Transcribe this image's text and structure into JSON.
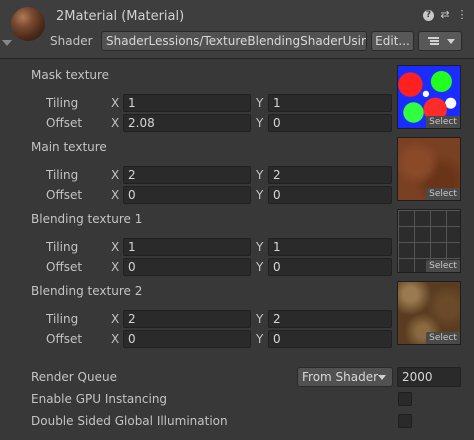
{
  "header": {
    "title": "2Material (Material)",
    "shader_label": "Shader",
    "shader_value": "ShaderLessions/TextureBlendingShaderUsir",
    "edit_label": "Edit...",
    "icons": [
      "help-icon",
      "settings-sliders-icon",
      "more-vert-icon",
      "list-icon"
    ]
  },
  "textures": [
    {
      "label": "Mask texture",
      "tiling_label": "Tiling",
      "offset_label": "Offset",
      "tiling_x": "1",
      "tiling_y": "1",
      "offset_x": "2.08",
      "offset_y": "0",
      "select_label": "Select"
    },
    {
      "label": "Main texture",
      "tiling_label": "Tiling",
      "offset_label": "Offset",
      "tiling_x": "2",
      "tiling_y": "2",
      "offset_x": "0",
      "offset_y": "0",
      "select_label": "Select"
    },
    {
      "label": "Blending texture 1",
      "tiling_label": "Tiling",
      "offset_label": "Offset",
      "tiling_x": "1",
      "tiling_y": "1",
      "offset_x": "0",
      "offset_y": "0",
      "select_label": "Select"
    },
    {
      "label": "Blending texture 2",
      "tiling_label": "Tiling",
      "offset_label": "Offset",
      "tiling_x": "2",
      "tiling_y": "2",
      "offset_x": "0",
      "offset_y": "0",
      "select_label": "Select"
    }
  ],
  "axis": {
    "x": "X",
    "y": "Y"
  },
  "render_queue": {
    "label": "Render Queue",
    "mode": "From Shader",
    "value": "2000"
  },
  "gpu_instancing": {
    "label": "Enable GPU Instancing",
    "checked": false
  },
  "double_sided_gi": {
    "label": "Double Sided Global Illumination",
    "checked": false
  }
}
